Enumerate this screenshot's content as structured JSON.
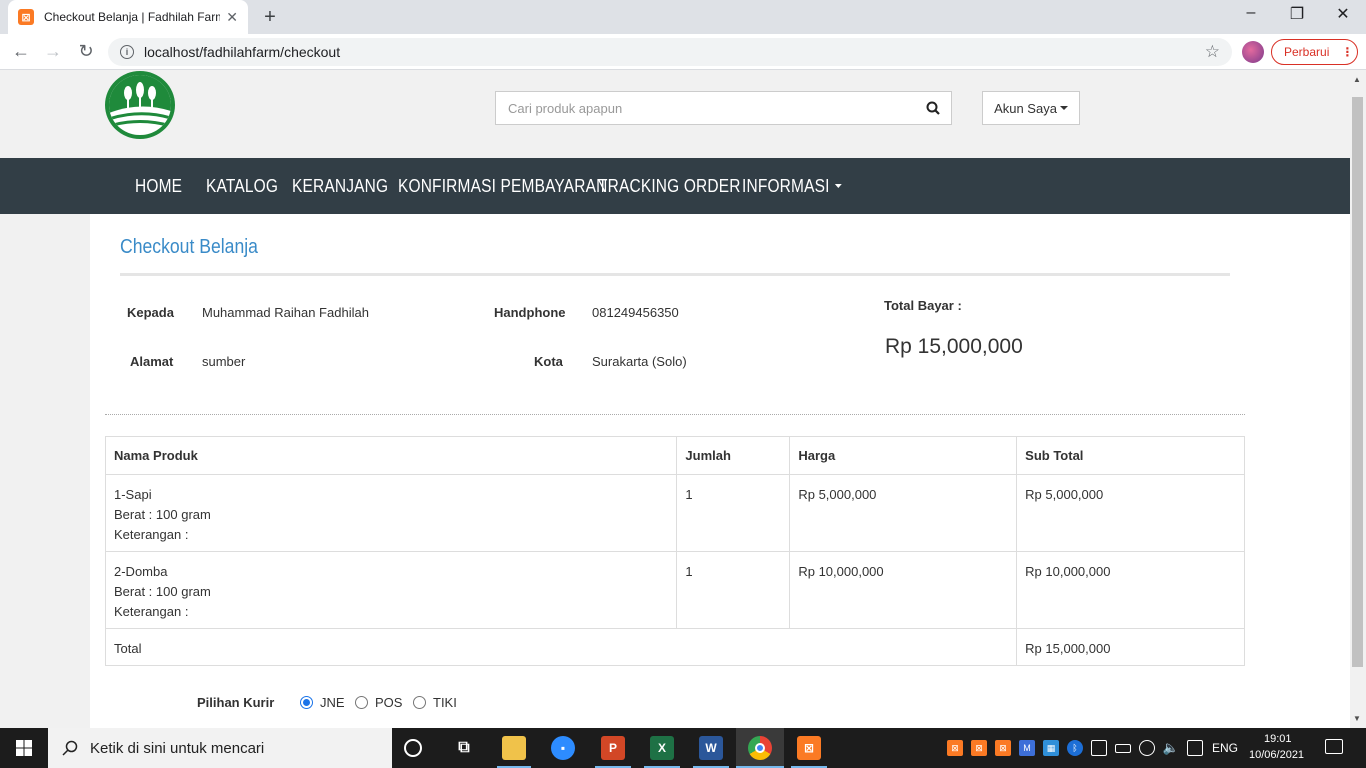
{
  "browser": {
    "tab_title": "Checkout Belanja | Fadhilah Farm",
    "url": "localhost/fadhilahfarm/checkout",
    "update_label": "Perbarui"
  },
  "header": {
    "search_placeholder": "Cari produk apapun",
    "account_label": "Akun Saya"
  },
  "nav": {
    "items": [
      "HOME",
      "KATALOG",
      "KERANJANG",
      "KONFIRMASI PEMBAYARAN",
      "TRACKING ORDER",
      "INFORMASI"
    ]
  },
  "checkout": {
    "title": "Checkout Belanja",
    "to_label": "Kepada",
    "to_value": "Muhammad Raihan Fadhilah",
    "phone_label": "Handphone",
    "phone_value": "081249456350",
    "address_label": "Alamat",
    "address_value": "sumber",
    "city_label": "Kota",
    "city_value": "Surakarta (Solo)",
    "total_label": "Total Bayar :",
    "total_value": "Rp 15,000,000"
  },
  "table": {
    "headers": [
      "Nama Produk",
      "Jumlah",
      "Harga",
      "Sub Total"
    ],
    "rows": [
      {
        "name": "1-Sapi",
        "weight": "Berat : 100 gram",
        "note": "Keterangan :",
        "qty": "1",
        "price": "Rp 5,000,000",
        "subtotal": "Rp 5,000,000"
      },
      {
        "name": "2-Domba",
        "weight": "Berat : 100 gram",
        "note": "Keterangan :",
        "qty": "1",
        "price": "Rp 10,000,000",
        "subtotal": "Rp 10,000,000"
      }
    ],
    "total_label": "Total",
    "total_value": "Rp 15,000,000"
  },
  "courier": {
    "label": "Pilihan Kurir",
    "options": [
      "JNE",
      "POS",
      "TIKI"
    ],
    "selected": "JNE"
  },
  "taskbar": {
    "search_text": "Ketik di sini untuk mencari",
    "language": "ENG",
    "time": "19:01",
    "date": "10/06/2021"
  }
}
